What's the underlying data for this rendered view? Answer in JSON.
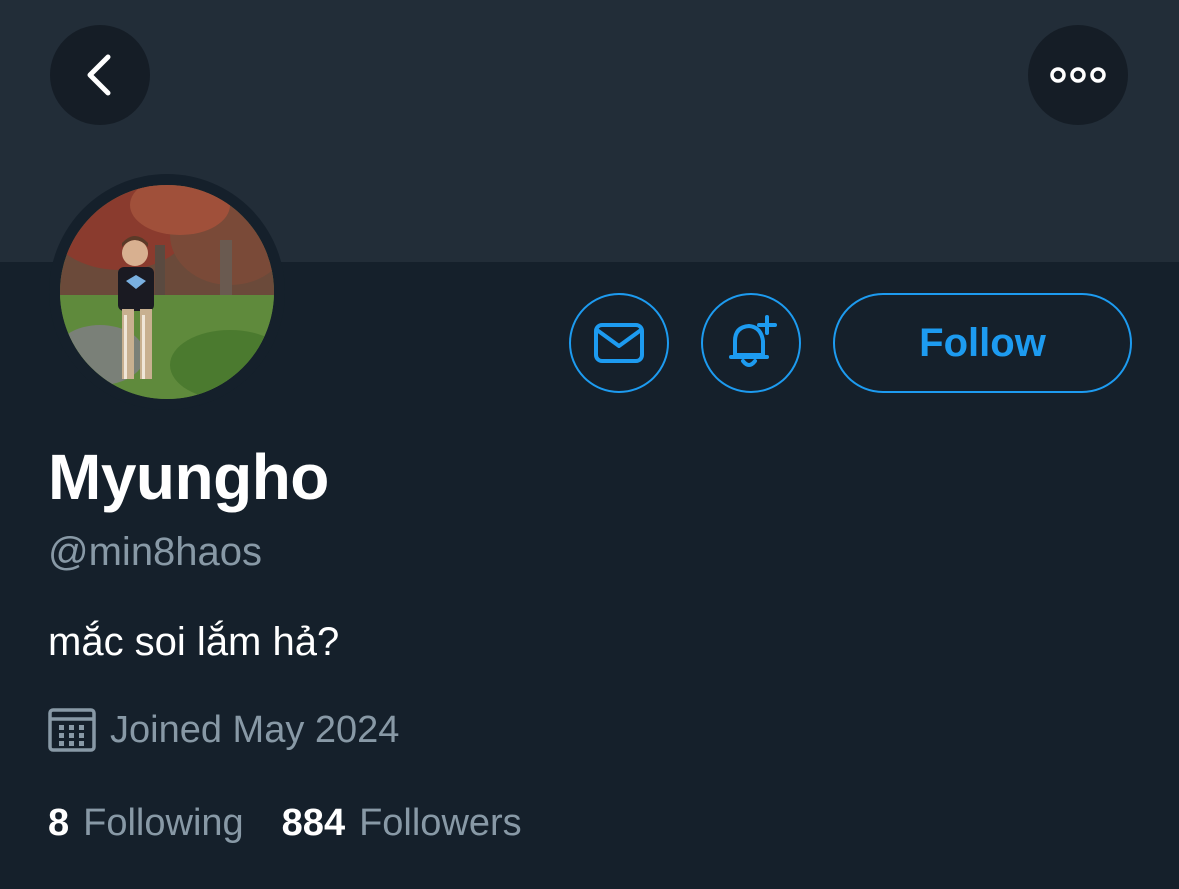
{
  "header": {
    "back_icon": "chevron-left-icon",
    "more_icon": "more-dots-icon"
  },
  "profile": {
    "display_name": "Myungho",
    "handle": "@min8haos",
    "bio": "mắc soi lắm hả?",
    "joined": "Joined May 2024",
    "following_count": "8",
    "following_label": "Following",
    "followers_count": "884",
    "followers_label": "Followers"
  },
  "actions": {
    "message_icon": "envelope-icon",
    "notify_icon": "bell-plus-icon",
    "follow_label": "Follow"
  },
  "colors": {
    "background": "#15202b",
    "banner": "#222d38",
    "accent": "#1d9bf0",
    "secondary_text": "#8899a6"
  }
}
